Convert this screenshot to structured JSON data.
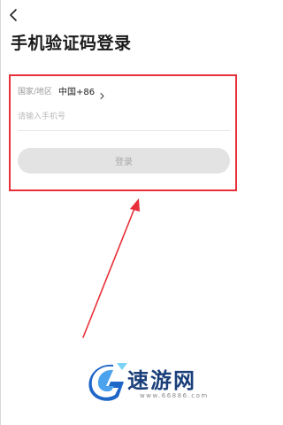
{
  "header": {
    "title": "手机验证码登录",
    "back_icon": "chevron-left-icon"
  },
  "form": {
    "country_label": "国家/地区",
    "country_value": "中国+86",
    "country_icon": "chevron-right-icon",
    "phone_placeholder": "请输入手机号",
    "phone_value": "",
    "login_label": "登录"
  },
  "annotation": {
    "highlight_color": "#e8303a"
  },
  "watermark": {
    "brand": "速游网",
    "url": "www.66886.com"
  }
}
